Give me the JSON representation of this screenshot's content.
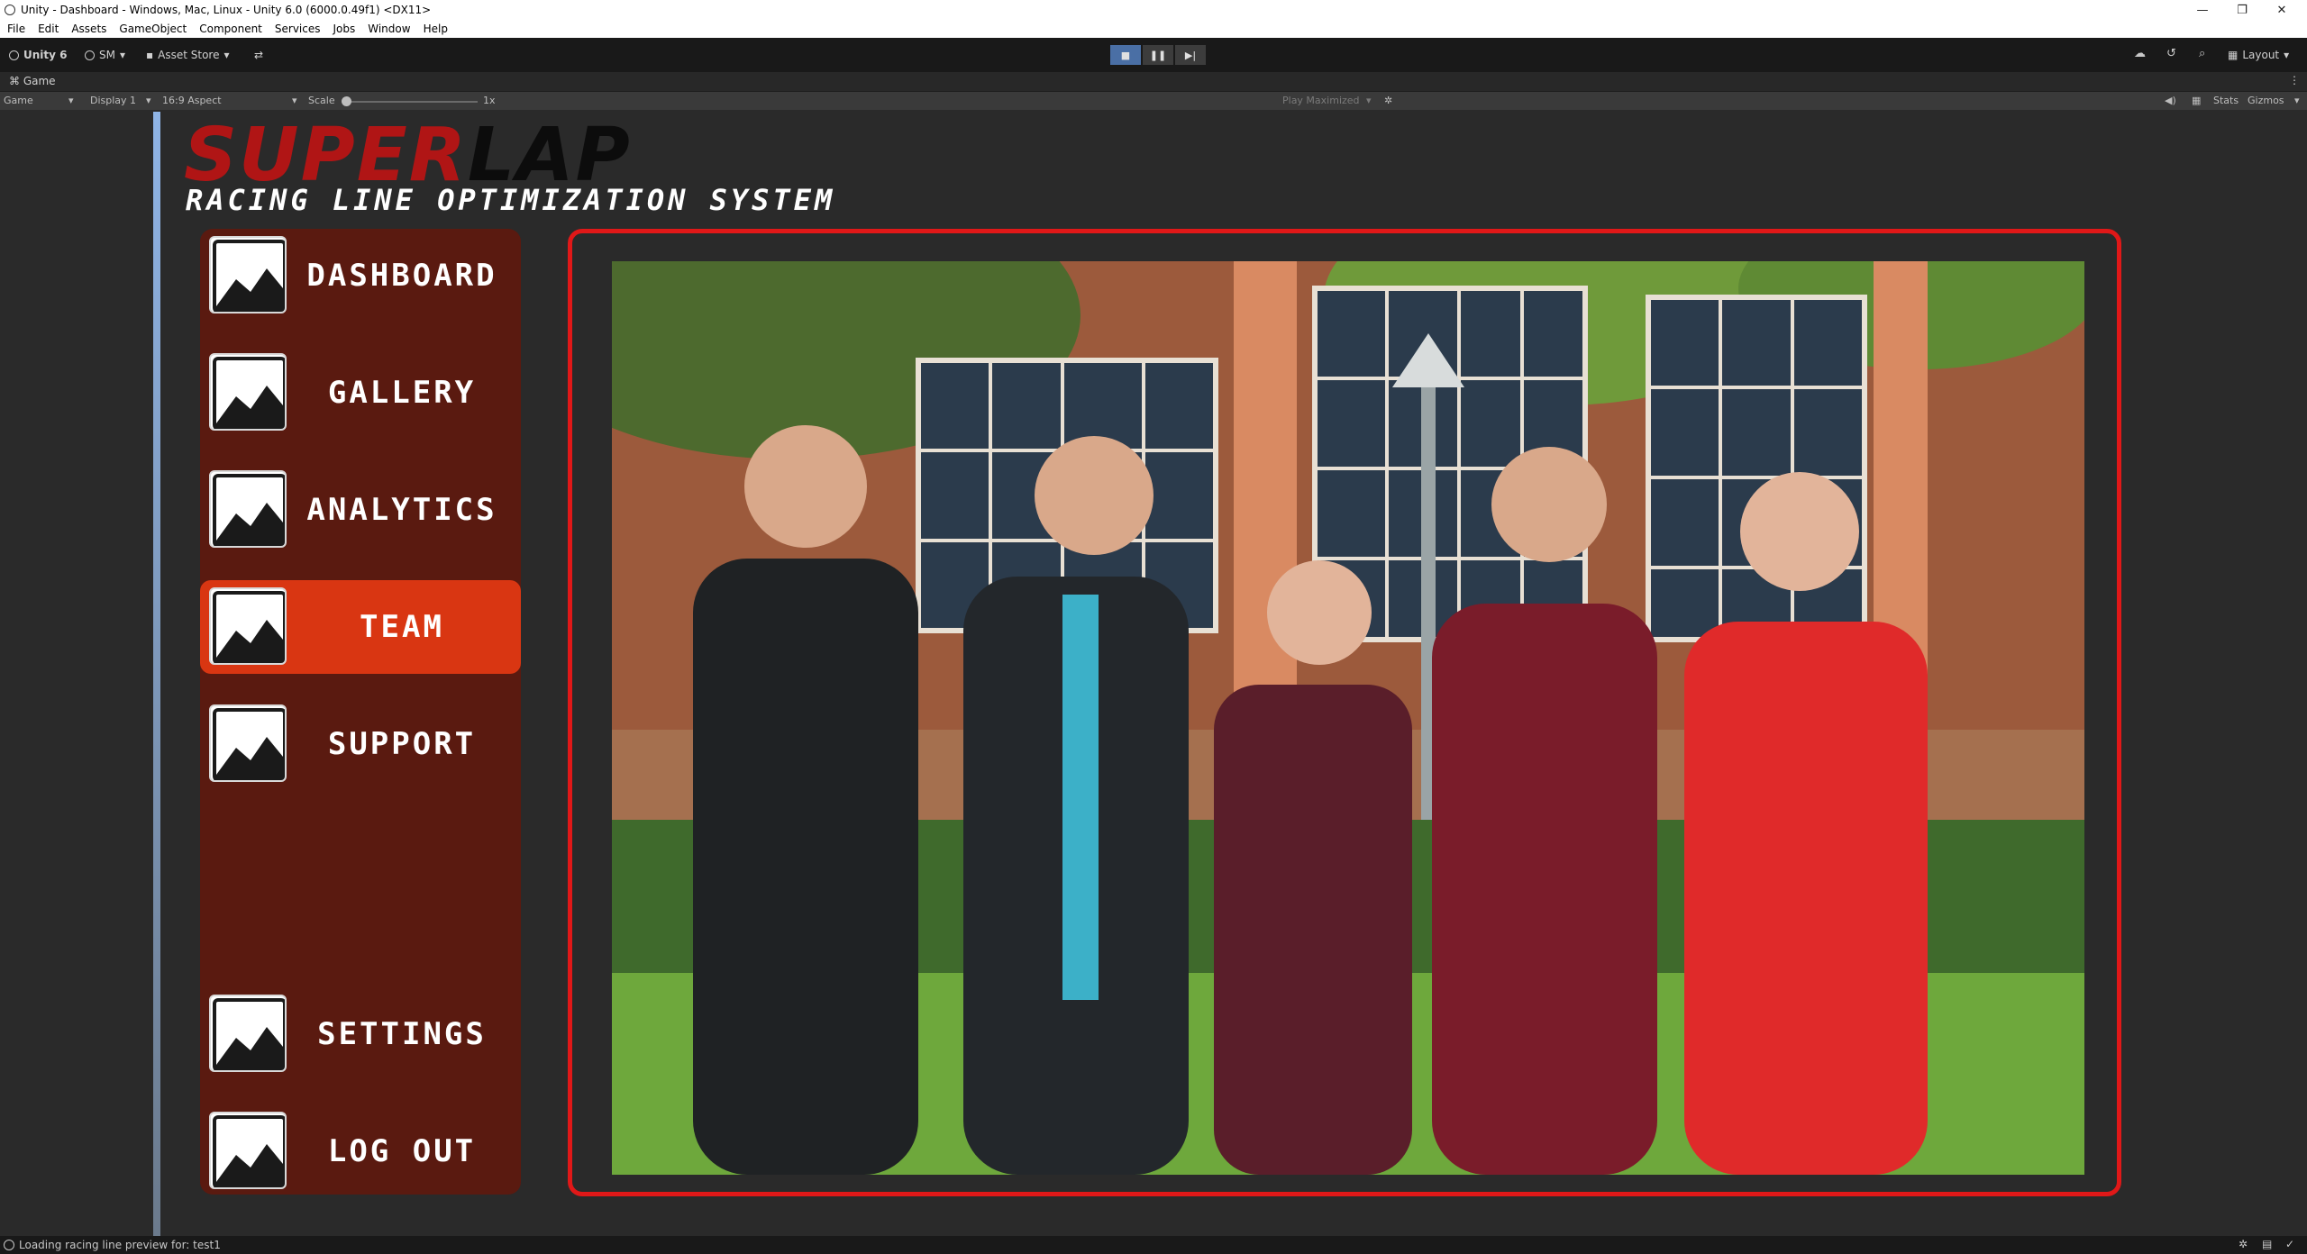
{
  "window": {
    "title": "Unity - Dashboard - Windows, Mac, Linux - Unity 6.0 (6000.0.49f1) <DX11>",
    "minimize": "—",
    "maximize": "❐",
    "close": "✕"
  },
  "menubar": [
    "File",
    "Edit",
    "Assets",
    "GameObject",
    "Component",
    "Services",
    "Jobs",
    "Window",
    "Help"
  ],
  "toolbar": {
    "unity_label": "Unity 6",
    "account_label": "SM",
    "asset_store_label": "Asset Store",
    "layout_label": "Layout"
  },
  "game_tab": {
    "label": "Game"
  },
  "game_bar": {
    "mode": "Game",
    "display": "Display 1",
    "aspect": "16:9 Aspect",
    "scale_label": "Scale",
    "scale_value": "1x",
    "play_mode": "Play Maximized",
    "stats": "Stats",
    "gizmos": "Gizmos"
  },
  "app": {
    "logo_part1": "SUPER",
    "logo_part2": "LAP",
    "subtitle": "RACING LINE OPTIMIZATION SYSTEM",
    "nav": [
      {
        "label": "DASHBOARD",
        "icon": "image-icon",
        "active": false
      },
      {
        "label": "GALLERY",
        "icon": "image-icon",
        "active": false
      },
      {
        "label": "ANALYTICS",
        "icon": "image-icon",
        "active": false
      },
      {
        "label": "TEAM",
        "icon": "image-icon",
        "active": true
      },
      {
        "label": "SUPPORT",
        "icon": "image-icon",
        "active": false
      },
      {
        "label": "SETTINGS",
        "icon": "image-icon",
        "active": false
      },
      {
        "label": "LOG OUT",
        "icon": "image-icon",
        "active": false
      }
    ],
    "colors": {
      "sidebar_bg": "#5a1a10",
      "active_nav": "#d93612",
      "panel_border": "#e01818",
      "logo_red": "#b01515"
    }
  },
  "statusbar": {
    "message": "Loading racing line preview for: test1"
  }
}
